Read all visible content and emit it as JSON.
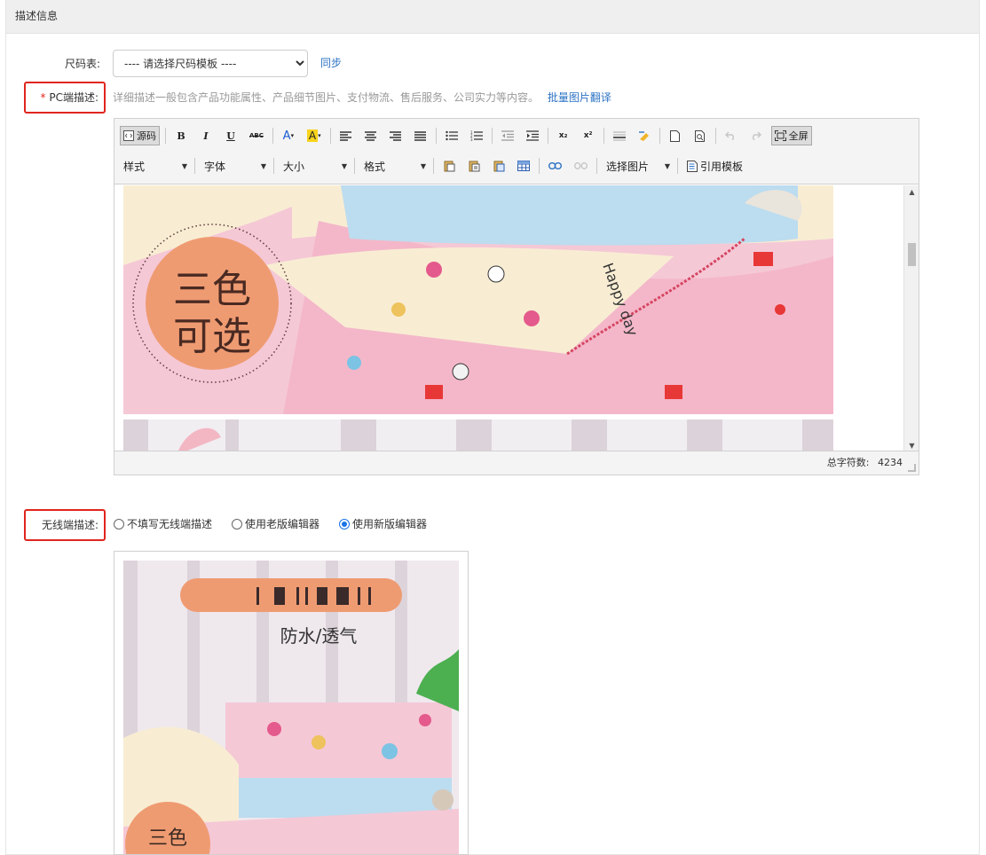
{
  "panel": {
    "title": "描述信息"
  },
  "size_chart": {
    "label": "尺码表:",
    "select_value": "---- 请选择尺码模板 ----",
    "sync_link": "同步"
  },
  "pc_desc": {
    "required_star": "*",
    "label": "PC端描述:",
    "hint": "详细描述一般包含产品功能属性、产品细节图片、支付物流、售后服务、公司实力等内容。",
    "batch_translate_link": "批量图片翻译"
  },
  "toolbar": {
    "source_label": "源码",
    "bold": "B",
    "italic": "I",
    "underline": "U",
    "strike": "ABC",
    "subscript": "x₂",
    "superscript": "x²",
    "fullscreen_label": "全屏",
    "style_dropdown": "样式",
    "font_dropdown": "字体",
    "size_dropdown": "大小",
    "format_dropdown": "格式",
    "select_image_dropdown": "选择图片",
    "template_label": "引用模板",
    "colors": {
      "text_color": "#1a5ccf",
      "highlight_color": "#f7d31c"
    }
  },
  "editor_images": {
    "banner_text_line1": "三色",
    "banner_text_line2": "可选",
    "cloth_text": "Happy day",
    "colors": {
      "pink": "#f5c8d6",
      "cream": "#f8edd3",
      "blue": "#bcdcef",
      "orange": "#ef9b72"
    }
  },
  "statusbar": {
    "char_count_label": "总字符数:",
    "char_count_value": "4234"
  },
  "mobile_desc": {
    "label": "无线端描述:",
    "options": [
      {
        "label": "不填写无线端描述",
        "checked": false
      },
      {
        "label": "使用老版编辑器",
        "checked": false
      },
      {
        "label": "使用新版编辑器",
        "checked": true
      }
    ],
    "preview_title": "防水/透气",
    "preview_badge": "三色",
    "accent_color": "#1a73e8"
  }
}
